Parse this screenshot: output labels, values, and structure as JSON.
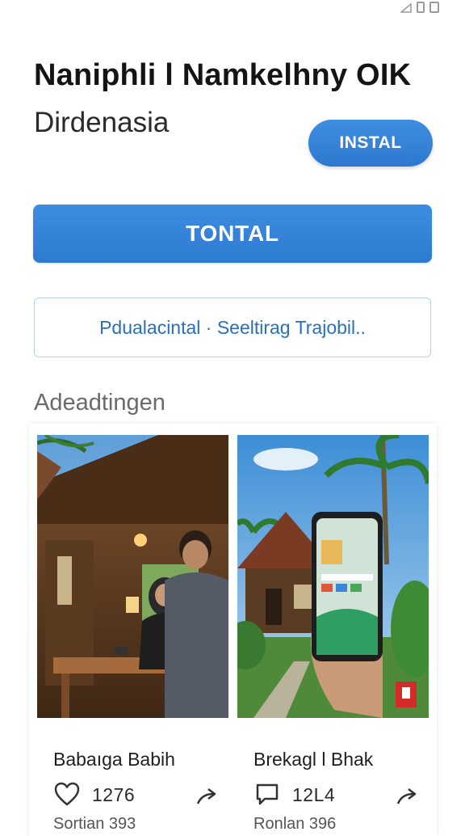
{
  "app": {
    "title": "Naniphli l Namkelhny OIK",
    "subtitle": "Dirdenasia",
    "install_small_label": "INSTAL",
    "primary_button_label": "TONTAL",
    "secondary_link_label": "Pdualacintal · Seeltirag Trajobil.."
  },
  "section": {
    "heading": "Adeadtingen"
  },
  "cards": [
    {
      "title": "Babaıga Babih",
      "count": "1276",
      "sub": "Sortian 393",
      "meta_icon": "heart-icon",
      "share_icon": "share-arrow-icon"
    },
    {
      "title": "Brekagl l Bhak",
      "count": "12L4",
      "sub": "Ronlan 396",
      "meta_icon": "comment-icon",
      "share_icon": "share-arrow-icon"
    }
  ],
  "colors": {
    "accent": "#3384d8",
    "outline": "#b9cfe6",
    "link_text": "#2a6fbd"
  }
}
